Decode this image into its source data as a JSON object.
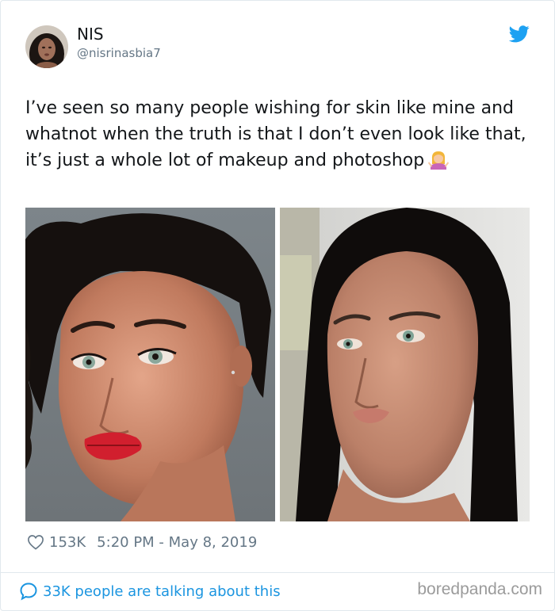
{
  "tweet": {
    "author_name": "NIS",
    "author_handle": "@nisrinasbia7",
    "text": "I’ve seen so many people wishing for skin like mine and whatnot when the truth is that I don’t even look like that, it’s just a whole lot of makeup and photoshop",
    "emoji": "person-shrugging",
    "likes": "153K",
    "timestamp": "5:20 PM - May 8, 2019",
    "talking": "33K people are talking about this"
  },
  "photos": [
    {
      "subject": "woman with makeup, red lips, dark curly hair, grey background"
    },
    {
      "subject": "woman without makeup, long straight black hair, light background"
    }
  ],
  "icons": {
    "brand": "twitter-bird-icon",
    "like": "heart-icon",
    "talk": "speech-bubble-icon"
  },
  "colors": {
    "twitter_blue": "#1da1f2",
    "link_blue": "#1b95e0",
    "secondary_text": "#657786",
    "primary_text": "#14171a"
  },
  "watermark": "boredpanda.com"
}
